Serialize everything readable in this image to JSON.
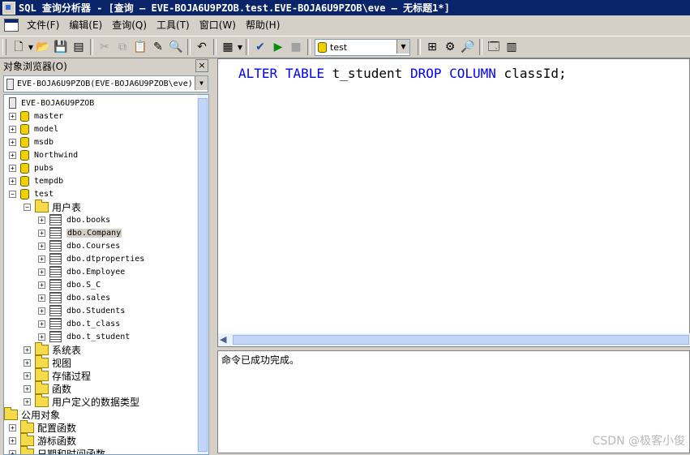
{
  "window": {
    "title": "SQL 查询分析器 - [查询 — EVE-BOJA6U9PZOB.test.EVE-BOJA6U9PZOB\\eve — 无标题1*]"
  },
  "menu": {
    "items": [
      "文件(F)",
      "编辑(E)",
      "查询(Q)",
      "工具(T)",
      "窗口(W)",
      "帮助(H)"
    ]
  },
  "toolbar": {
    "database": "test"
  },
  "object_browser": {
    "title": "对象浏览器(O)",
    "close_label": "×",
    "server_selector": "EVE-BOJA6U9PZOB(EVE-BOJA6U9PZOB\\eve)",
    "root": "EVE-BOJA6U9PZOB",
    "databases": [
      "master",
      "model",
      "msdb",
      "Northwind",
      "pubs",
      "tempdb",
      "test"
    ],
    "user_tables_folder": "用户表",
    "tables": [
      "dbo.books",
      "dbo.Company",
      "dbo.Courses",
      "dbo.dtproperties",
      "dbo.Employee",
      "dbo.S_C",
      "dbo.sales",
      "dbo.Students",
      "dbo.t_class",
      "dbo.t_student"
    ],
    "selected_table": "dbo.Company",
    "test_folders": [
      "系统表",
      "视图",
      "存储过程",
      "函数",
      "用户定义的数据类型"
    ],
    "common_objects": "公用对象",
    "common_children": [
      "配置函数",
      "游标函数",
      "日期和时间函数"
    ]
  },
  "editor": {
    "tokens": [
      {
        "text": "ALTER",
        "kw": true
      },
      {
        "text": " ",
        "kw": false
      },
      {
        "text": "TABLE",
        "kw": true
      },
      {
        "text": " t_student ",
        "kw": false
      },
      {
        "text": "DROP",
        "kw": true
      },
      {
        "text": " ",
        "kw": false
      },
      {
        "text": "COLUMN",
        "kw": true
      },
      {
        "text": " classId;",
        "kw": false
      }
    ]
  },
  "results": {
    "message": "命令已成功完成。"
  },
  "watermark": "CSDN @极客小俊",
  "colors": {
    "keyword": "#0000ff",
    "title_bar": "#0a246a",
    "chrome": "#d4d0c8"
  }
}
